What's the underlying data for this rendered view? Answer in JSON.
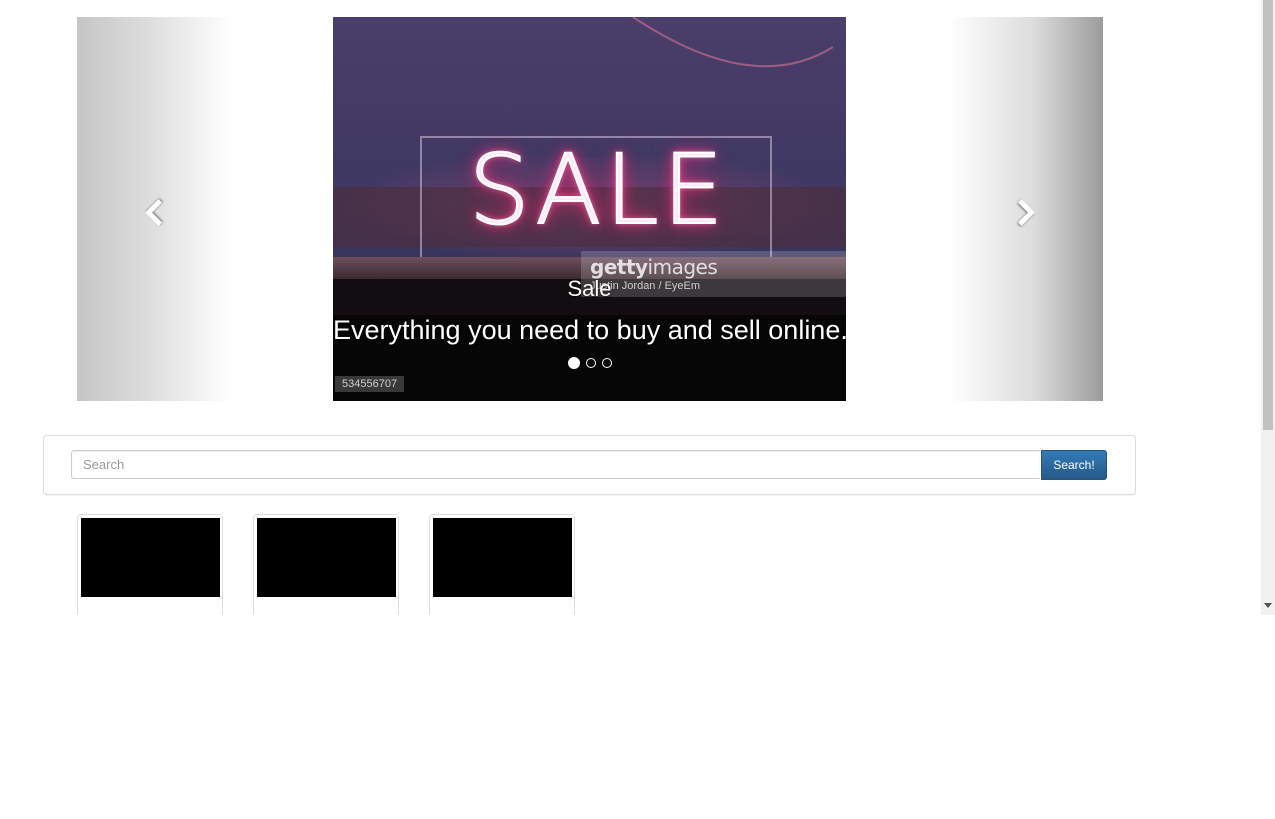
{
  "carousel": {
    "prev_label": "Previous",
    "next_label": "Next",
    "slide": {
      "image_text": "SALE",
      "watermark_brand_bold": "getty",
      "watermark_brand_rest": "images",
      "watermark_credit": "Justin Jordan / EyeEm",
      "caption_title": "Sale",
      "caption_text": "Everything you need to buy and sell online.",
      "image_id": "534556707"
    },
    "indicators": [
      {
        "active": true
      },
      {
        "active": false
      },
      {
        "active": false
      }
    ]
  },
  "search": {
    "placeholder": "Search",
    "value": "",
    "button_label": "Search!",
    "button_color": "#337ab7"
  },
  "thumbnails": [
    {
      "image_color": "#000000"
    },
    {
      "image_color": "#000000"
    },
    {
      "image_color": "#000000"
    }
  ],
  "icons": {
    "prev": "chevron-left-icon",
    "next": "chevron-right-icon",
    "scroll_down": "scroll-down-arrow-icon"
  }
}
